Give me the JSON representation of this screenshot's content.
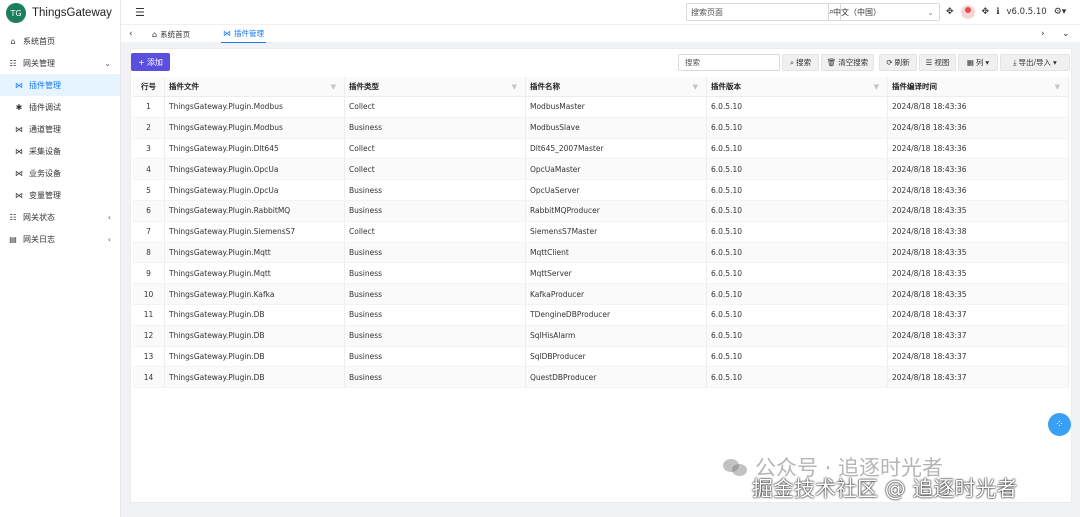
{
  "brand": {
    "logo": "TG",
    "name": "ThingsGateway"
  },
  "sidebar": {
    "items": [
      {
        "label": "系统首页",
        "icon": "home-icon",
        "glyph": "⌂",
        "level": 0,
        "expandable": false
      },
      {
        "label": "网关管理",
        "icon": "users-icon",
        "glyph": "☷",
        "level": 0,
        "expandable": true,
        "chev": "⌄"
      },
      {
        "label": "插件管理",
        "icon": "plugin-icon",
        "glyph": "⋈",
        "level": 1,
        "active": true
      },
      {
        "label": "插件调试",
        "icon": "bug-icon",
        "glyph": "✱",
        "level": 1
      },
      {
        "label": "通道管理",
        "icon": "channel-icon",
        "glyph": "⋈",
        "level": 1
      },
      {
        "label": "采集设备",
        "icon": "device-icon",
        "glyph": "⋈",
        "level": 1
      },
      {
        "label": "业务设备",
        "icon": "device-icon",
        "glyph": "⋈",
        "level": 1
      },
      {
        "label": "变量管理",
        "icon": "variable-icon",
        "glyph": "⋈",
        "level": 1
      },
      {
        "label": "网关状态",
        "icon": "status-icon",
        "glyph": "☷",
        "level": 0,
        "expandable": true,
        "chev": "‹"
      },
      {
        "label": "网关日志",
        "icon": "log-icon",
        "glyph": "▤",
        "level": 0,
        "expandable": true,
        "chev": "‹"
      }
    ]
  },
  "header": {
    "search_placeholder": "搜索页面",
    "language": "中文（中国）",
    "version": "v6.0.5.10"
  },
  "tabs": {
    "items": [
      {
        "label": "系统首页",
        "icon": "home-icon",
        "glyph": "⌂"
      },
      {
        "label": "插件管理",
        "icon": "plugin-icon",
        "glyph": "⋈",
        "active": true
      }
    ]
  },
  "toolbar": {
    "add": "添加",
    "search_placeholder": "搜索",
    "search_btn": "搜索",
    "clear_btn": "清空搜索",
    "refresh_btn": "刷新",
    "view_btn": "视图",
    "columns_btn": "列",
    "export_btn": "导出/导入"
  },
  "table": {
    "headers": [
      "行号",
      "插件文件",
      "插件类型",
      "插件名称",
      "插件版本",
      "插件编译时间"
    ],
    "rows": [
      [
        "1",
        "ThingsGateway.Plugin.Modbus",
        "Collect",
        "ModbusMaster",
        "6.0.5.10",
        "2024/8/18 18:43:36"
      ],
      [
        "2",
        "ThingsGateway.Plugin.Modbus",
        "Business",
        "ModbusSlave",
        "6.0.5.10",
        "2024/8/18 18:43:36"
      ],
      [
        "3",
        "ThingsGateway.Plugin.Dlt645",
        "Collect",
        "Dlt645_2007Master",
        "6.0.5.10",
        "2024/8/18 18:43:36"
      ],
      [
        "4",
        "ThingsGateway.Plugin.OpcUa",
        "Collect",
        "OpcUaMaster",
        "6.0.5.10",
        "2024/8/18 18:43:36"
      ],
      [
        "5",
        "ThingsGateway.Plugin.OpcUa",
        "Business",
        "OpcUaServer",
        "6.0.5.10",
        "2024/8/18 18:43:36"
      ],
      [
        "6",
        "ThingsGateway.Plugin.RabbitMQ",
        "Business",
        "RabbitMQProducer",
        "6.0.5.10",
        "2024/8/18 18:43:35"
      ],
      [
        "7",
        "ThingsGateway.Plugin.SiemensS7",
        "Collect",
        "SiemensS7Master",
        "6.0.5.10",
        "2024/8/18 18:43:38"
      ],
      [
        "8",
        "ThingsGateway.Plugin.Mqtt",
        "Business",
        "MqttClient",
        "6.0.5.10",
        "2024/8/18 18:43:35"
      ],
      [
        "9",
        "ThingsGateway.Plugin.Mqtt",
        "Business",
        "MqttServer",
        "6.0.5.10",
        "2024/8/18 18:43:35"
      ],
      [
        "10",
        "ThingsGateway.Plugin.Kafka",
        "Business",
        "KafkaProducer",
        "6.0.5.10",
        "2024/8/18 18:43:35"
      ],
      [
        "11",
        "ThingsGateway.Plugin.DB",
        "Business",
        "TDengineDBProducer",
        "6.0.5.10",
        "2024/8/18 18:43:37"
      ],
      [
        "12",
        "ThingsGateway.Plugin.DB",
        "Business",
        "SqlHisAlarm",
        "6.0.5.10",
        "2024/8/18 18:43:37"
      ],
      [
        "13",
        "ThingsGateway.Plugin.DB",
        "Business",
        "SqlDBProducer",
        "6.0.5.10",
        "2024/8/18 18:43:37"
      ],
      [
        "14",
        "ThingsGateway.Plugin.DB",
        "Business",
        "QuestDBProducer",
        "6.0.5.10",
        "2024/8/18 18:43:37"
      ]
    ]
  },
  "watermark": {
    "line1": "公众号 · 追逐时光者",
    "line2": "掘金技术社区 @ 追逐时光者"
  },
  "colors": {
    "accent": "#1677ff",
    "add_button": "#5b4fe0",
    "brand": "#1a7f5a",
    "float_button": "#3aa0f5"
  }
}
